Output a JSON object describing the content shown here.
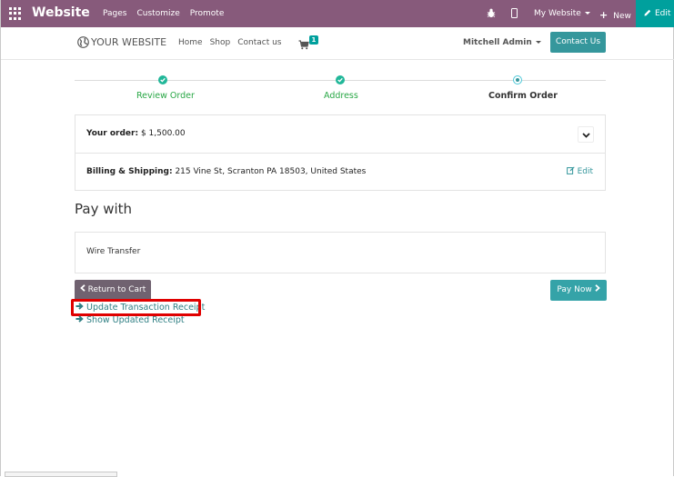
{
  "admin_bar": {
    "brand": "Website",
    "menu": [
      "Pages",
      "Customize",
      "Promote"
    ],
    "my_website": "My Website",
    "new_label": "New",
    "edit_label": "Edit",
    "color": "#875a7b",
    "accent": "#00a09d"
  },
  "site_header": {
    "logo": "YOUR WEBSITE",
    "nav": [
      "Home",
      "Shop",
      "Contact us"
    ],
    "cart_count": "1",
    "user": "Mitchell Admin",
    "contact_button": "Contact Us"
  },
  "checkout_steps": [
    {
      "label": "Review Order",
      "status": "done"
    },
    {
      "label": "Address",
      "status": "done"
    },
    {
      "label": "Confirm Order",
      "status": "current"
    }
  ],
  "order_summary": {
    "order_label": "Your order:",
    "order_value": "$ 1,500.00",
    "billing_label": "Billing & Shipping:",
    "billing_value": "215 Vine St, Scranton PA 18503, United States",
    "edit_label": "Edit"
  },
  "payment": {
    "heading": "Pay with",
    "method": "Wire Transfer",
    "return_label": "Return to Cart",
    "pay_label": "Pay Now"
  },
  "links": {
    "update_receipt": "Update Transaction Receipt",
    "show_receipt": "Show Updated Receipt"
  },
  "icons": [
    "apps-grid-icon",
    "bug-icon",
    "mobile-icon",
    "plus-icon",
    "pencil-icon",
    "globe-icon",
    "cart-icon",
    "check-icon",
    "chevron-down-icon",
    "edit-icon",
    "chevron-left-icon",
    "chevron-right-icon",
    "arrow-right-icon"
  ],
  "colors": {
    "teal": "#35979c",
    "success": "#28a745",
    "highlight": "#e00000"
  }
}
